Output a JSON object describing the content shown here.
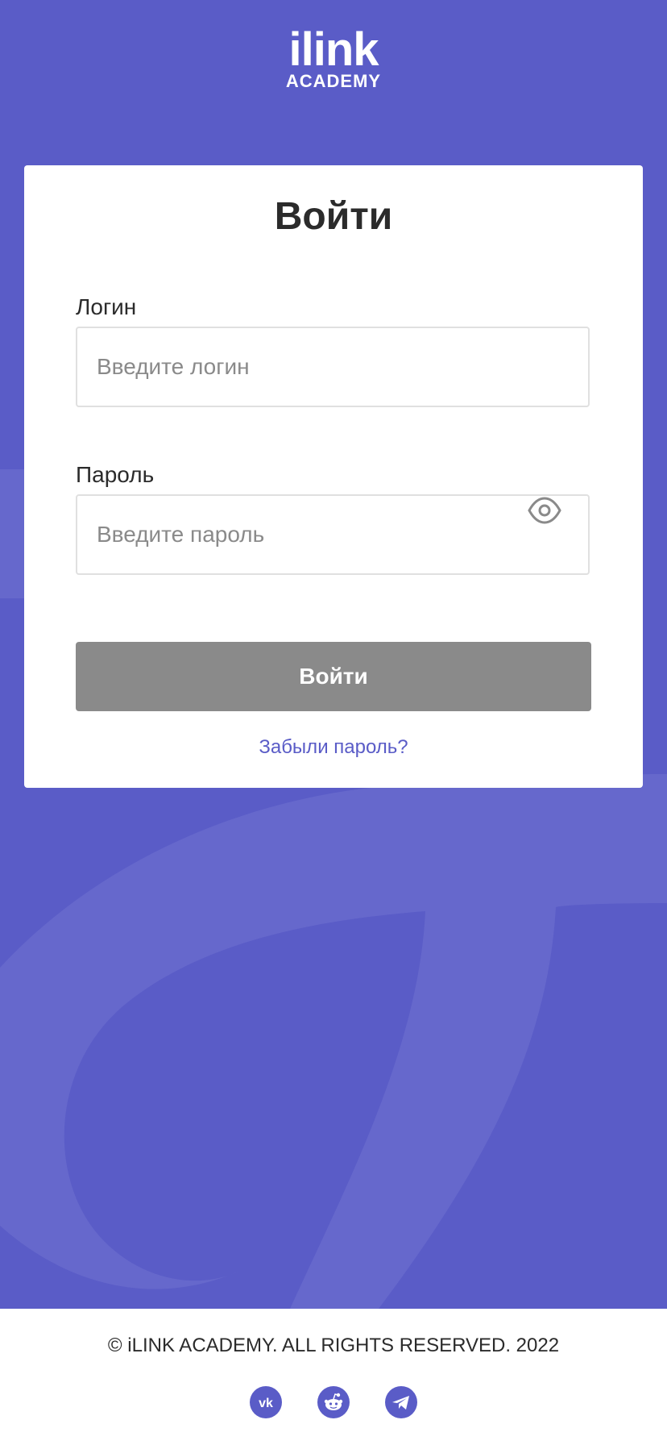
{
  "logo": {
    "main": "ilink",
    "sub": "ACADEMY"
  },
  "card": {
    "title": "Войти",
    "login_label": "Логин",
    "login_placeholder": "Введите логин",
    "login_value": "",
    "password_label": "Пароль",
    "password_placeholder": "Введите пароль",
    "password_value": "",
    "submit_label": "Войти",
    "forgot_label": "Забыли пароль?"
  },
  "footer": {
    "copyright": "© iLINK ACADEMY. ALL RIGHTS RESERVED. 2022",
    "social_vk_text": "vk",
    "socials": [
      "vk-icon",
      "reddit-icon",
      "telegram-icon"
    ]
  },
  "colors": {
    "brand": "#5a5cc7",
    "button_disabled": "#8a8a8a",
    "text": "#2b2b2b"
  }
}
